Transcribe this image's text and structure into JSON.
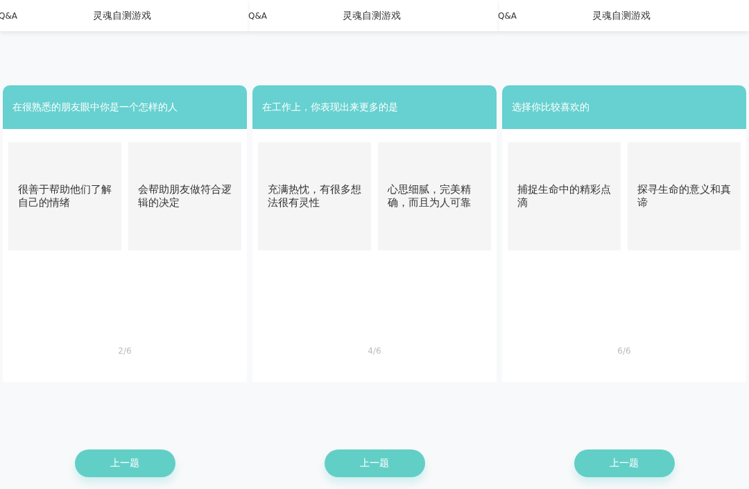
{
  "screens": [
    {
      "nav": {
        "left": "Q&A",
        "title": "灵魂自测游戏"
      },
      "question": "在很熟悉的朋友眼中你是一个怎样的人",
      "options": [
        "很善于帮助他们了解自己的情绪",
        "会帮助朋友做符合逻辑的决定"
      ],
      "progress": "2/6",
      "button": "上一题"
    },
    {
      "nav": {
        "left": "Q&A",
        "title": "灵魂自测游戏"
      },
      "question": "在工作上，你表现出来更多的是",
      "options": [
        "充满热忱，有很多想法很有灵性",
        "心思细腻，完美精确，而且为人可靠"
      ],
      "progress": "4/6",
      "button": "上一题"
    },
    {
      "nav": {
        "left": "Q&A",
        "title": "灵魂自测游戏"
      },
      "question": "选择你比较喜欢的",
      "options": [
        "捕捉生命中的精彩点滴",
        "探寻生命的意义和真谛"
      ],
      "progress": "6/6",
      "button": "上一题"
    }
  ]
}
